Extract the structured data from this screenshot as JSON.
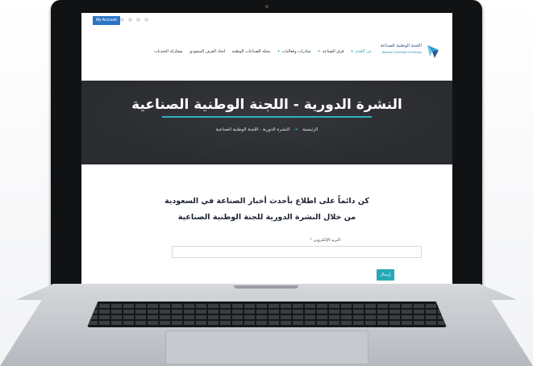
{
  "topbar": {
    "account_label": "My Account"
  },
  "logo": {
    "title": "اللجنة الوطنية للصناعة",
    "subtitle": "National Committee of Industry"
  },
  "nav": {
    "items": [
      {
        "label": "عن اللجنة",
        "active": true
      },
      {
        "label": "فرق الصناعة",
        "active": false
      },
      {
        "label": "مبادرات وفعاليات",
        "active": false
      },
      {
        "label": "مجلة الصناعات الوطنية",
        "active": false
      },
      {
        "label": "اتحاد الغرف السعودي",
        "active": false
      },
      {
        "label": "مشاركة التحديات",
        "active": false
      }
    ]
  },
  "hero": {
    "title": "النشرة الدورية - اللجنة الوطنية الصناعية",
    "breadcrumb_home": "الرئيسية",
    "breadcrumb_current": "النشرة الدورية - اللجنة الوطنية الصناعية"
  },
  "form": {
    "headline_line1": "كن دائماً على اطلاع بأحدث أخبار الصناعة في السعودية",
    "headline_line2": "من خلال النشرة الدورية للجنة الوطنية الصناعية",
    "email_label": "البريد الإلكتروني",
    "required_mark": "*",
    "email_value": "",
    "submit_label": "إرسال"
  },
  "colors": {
    "accent": "#27a9b5",
    "hero_bg": "#2a2c30",
    "account_btn": "#2a74c7"
  }
}
